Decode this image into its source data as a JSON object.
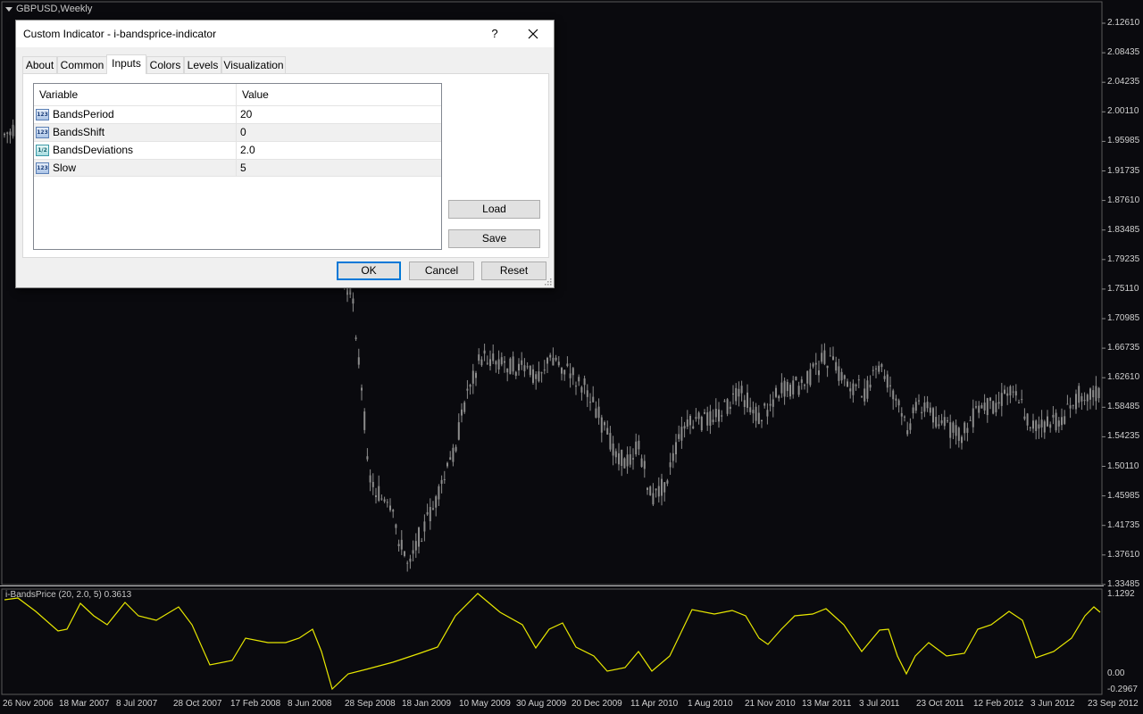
{
  "chart": {
    "title": "GBPUSD,Weekly",
    "indicator_title": "i-BandsPrice (20, 2.0, 5) 0.3613",
    "price_labels": [
      "2.12610",
      "2.08435",
      "2.04235",
      "2.00110",
      "1.95985",
      "1.91735",
      "1.87610",
      "1.83485",
      "1.79235",
      "1.75110",
      "1.70985",
      "1.66735",
      "1.62610",
      "1.58485",
      "1.54235",
      "1.50110",
      "1.45985",
      "1.41735",
      "1.37610",
      "1.33485"
    ],
    "indicator_labels": [
      "1.1292",
      "0.00",
      "-0.2967"
    ],
    "date_labels": [
      "26 Nov 2006",
      "18 Mar 2007",
      "8 Jul 2007",
      "28 Oct 2007",
      "17 Feb 2008",
      "8 Jun 2008",
      "28 Sep 2008",
      "18 Jan 2009",
      "10 May 2009",
      "30 Aug 2009",
      "20 Dec 2009",
      "11 Apr 2010",
      "1 Aug 2010",
      "21 Nov 2010",
      "13 Mar 2011",
      "3 Jul 2011",
      "23 Oct 2011",
      "12 Feb 2012",
      "3 Jun 2012",
      "23 Sep 2012"
    ],
    "colors": {
      "background": "#0a0a0e",
      "candles": "#8c8c8c",
      "indicator_line": "#e8e800",
      "separator": "#c0c0c0"
    }
  },
  "dialog": {
    "title": "Custom Indicator - i-bandsprice-indicator",
    "help_label": "?",
    "tabs": [
      {
        "label": "About"
      },
      {
        "label": "Common"
      },
      {
        "label": "Inputs",
        "active": true
      },
      {
        "label": "Colors"
      },
      {
        "label": "Levels"
      },
      {
        "label": "Visualization"
      }
    ],
    "grid": {
      "headers": [
        "Variable",
        "Value"
      ],
      "rows": [
        {
          "icon": "123",
          "name": "BandsPeriod",
          "value": "20"
        },
        {
          "icon": "123",
          "name": "BandsShift",
          "value": "0"
        },
        {
          "icon": "1/2",
          "name": "BandsDeviations",
          "value": "2.0"
        },
        {
          "icon": "123",
          "name": "Slow",
          "value": "5"
        }
      ]
    },
    "load_label": "Load",
    "save_label": "Save",
    "ok_label": "OK",
    "cancel_label": "Cancel",
    "reset_label": "Reset"
  }
}
